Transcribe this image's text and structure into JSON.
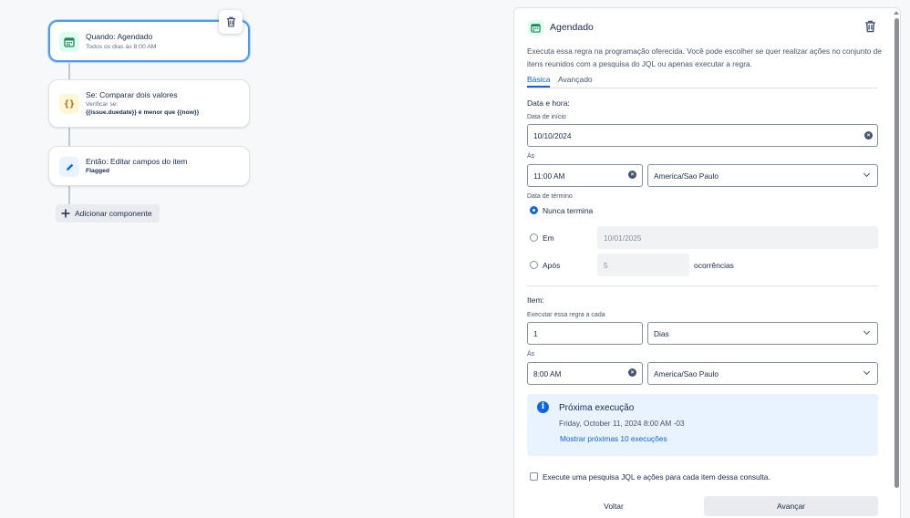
{
  "flow": {
    "trigger": {
      "title": "Quando: Agendado",
      "subtitle": "Todos os dias às 8:00 AM"
    },
    "condition": {
      "title": "Se: Comparar dois valores",
      "subtitle": "Verificar se:",
      "detail": "{{issue.duedate}} é menor que {{now}}"
    },
    "action": {
      "title": "Então: Editar campos do item",
      "detail": "Flagged"
    },
    "add_component_label": "Adicionar componente"
  },
  "panel": {
    "title": "Agendado",
    "description": "Executa essa regra na programação oferecida. Você pode escolher se quer realizar ações no conjunto de itens reunidos com a pesquisa do JQL ou apenas executar a regra.",
    "tabs": [
      {
        "label": "Básica",
        "active": true
      },
      {
        "label": "Avançado",
        "active": false
      }
    ],
    "datetime_section": "Data e hora:",
    "start_date_label": "Data de início",
    "start_date_value": "10/10/2024",
    "at_label": "Às",
    "start_time_value": "11:00 AM",
    "timezone_value": "America/Sao Paulo",
    "end_date_label": "Data de término",
    "end_options": {
      "never": "Nunca termina",
      "on": "Em",
      "on_value": "10/01/2025",
      "after": "Após",
      "after_value": "5",
      "occurrences_label": "ocorrências"
    },
    "item_section": "Item:",
    "run_every_label": "Executar essa regra a cada",
    "run_every_value": "1",
    "unit_value": "Dias",
    "at_label_2": "Às",
    "item_time_value": "8:00 AM",
    "item_timezone_value": "America/Sao Paulo",
    "next_run": {
      "title": "Próxima execução",
      "datetime": "Friday, October 11, 2024 8:00 AM -03",
      "link": "Mostrar próximas 10 execuções"
    },
    "jql_checkbox_label": "Execute uma pesquisa JQL e ações para cada item dessa consulta.",
    "back_button": "Voltar",
    "next_button": "Avançar"
  },
  "colors": {
    "accent": "#0c66e4",
    "selected_border": "#4c9aff",
    "trigger_icon_bg": "#dcfff1",
    "condition_icon_bg": "#fff7d6",
    "action_icon_bg": "#e9f2ff"
  },
  "icons": {
    "trigger": "calendar-icon",
    "condition": "braces-icon",
    "action": "pencil-icon",
    "delete": "trash-icon",
    "add": "plus-icon",
    "info": "info-icon"
  }
}
